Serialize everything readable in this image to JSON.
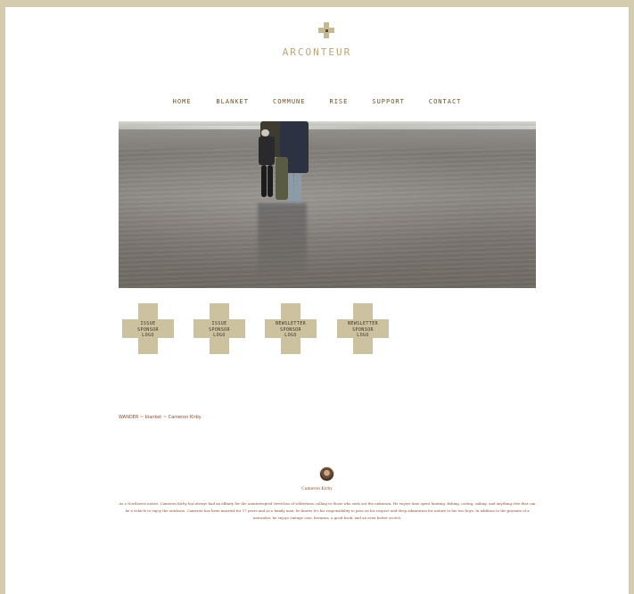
{
  "site": {
    "brand": "ARCONTEUR"
  },
  "nav": {
    "items": [
      {
        "label": "HOME"
      },
      {
        "label": "BLANKET"
      },
      {
        "label": "COMMUNE"
      },
      {
        "label": "RISE"
      },
      {
        "label": "SUPPORT"
      },
      {
        "label": "CONTACT"
      }
    ]
  },
  "sponsors": [
    {
      "label": "ISSUE\nSPONSOR\nLOGO"
    },
    {
      "label": "ISSUE\nSPONSOR\nLOGO"
    },
    {
      "label": "NEWSLETTER\nSPONSOR\nLOGO"
    },
    {
      "label": "NEWSLETTER\nSPONSOR\nLOGO"
    }
  ],
  "breadcrumb": {
    "text": "WANDER  ~  blanket  ~  Cameron Kirby"
  },
  "author": {
    "name": "Cameron Kirby",
    "bio": "As a Northwest native, Cameron Kirby has always had an affinity for the uninterrupted stretches of wilderness calling to those who seek out the unknown. He enjoys time spent hunting, fishing, caving, sailing, and anything else that can be a vehicle to enjoy the outdoors. Cameron has been married for 17 years and as a family man, he knows it's his responsibility to pass on his respect and deep admiration for nature to his two boys. In addition to the pursuits of a naturalist, he enjoys vintage cars, firearms, a good book, and an even better scotch."
  },
  "colors": {
    "frame": "#d5ccaf",
    "accent": "#cdc2a0",
    "text_brown": "#8a4e33",
    "nav_text": "#6b4f2d"
  }
}
